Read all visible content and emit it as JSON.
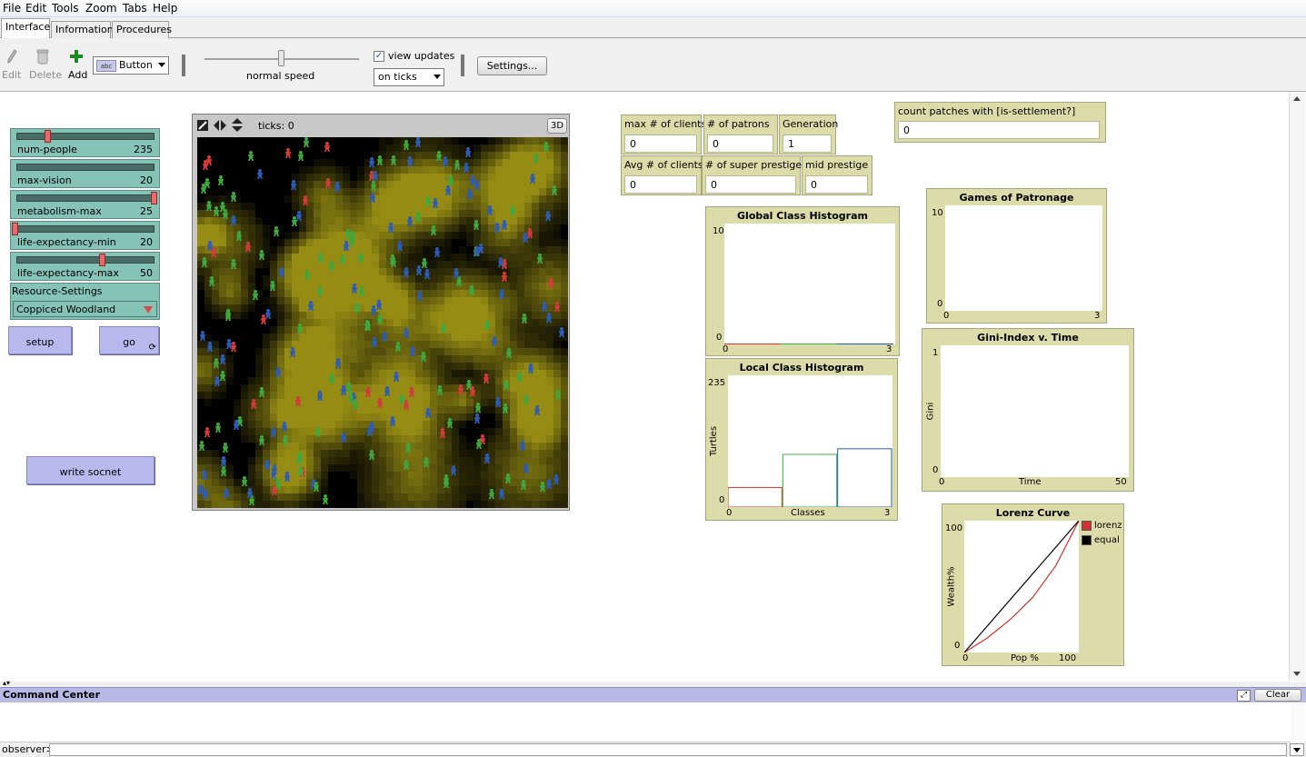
{
  "menu": [
    "File",
    "Edit",
    "Tools",
    "Zoom",
    "Tabs",
    "Help"
  ],
  "tabs": [
    "Interface",
    "Information",
    "Procedures"
  ],
  "toolbar": {
    "edit": "Edit",
    "delete": "Delete",
    "add": "Add",
    "widget_type": "Button",
    "widget_icon_text": "abc",
    "speed_label": "normal speed",
    "view_updates_label": "view updates",
    "update_mode": "on ticks",
    "settings": "Settings..."
  },
  "sliders": [
    {
      "label": "num-people",
      "value": "235",
      "level": 0.24
    },
    {
      "label": "max-vision",
      "value": "20",
      "level": 1.0
    },
    {
      "label": "metabolism-max",
      "value": "25",
      "level": 1.0
    },
    {
      "label": "life-expectancy-min",
      "value": "20",
      "level": 0.0
    },
    {
      "label": "life-expectancy-max",
      "value": "50",
      "level": 0.62
    }
  ],
  "chooser": {
    "label": "Resource-Settings",
    "value": "Coppiced Woodland"
  },
  "buttons": {
    "setup": "setup",
    "go": "go",
    "write_socnet": "write socnet"
  },
  "view": {
    "ticks_label": "ticks: 0",
    "three_d": "3D"
  },
  "monitors": {
    "max_clients": {
      "label": "max # of clients",
      "value": "0"
    },
    "patrons": {
      "label": "# of patrons",
      "value": "0"
    },
    "generation": {
      "label": "Generation",
      "value": "1"
    },
    "avg_clients": {
      "label": "Avg # of clients",
      "value": "0"
    },
    "super_prestige": {
      "label": "# of super prestige",
      "value": "0"
    },
    "mid_prestige": {
      "label": "mid prestige",
      "value": "0"
    },
    "settlement": {
      "label": "count patches with [is-settlement?]",
      "value": "0"
    }
  },
  "plots": {
    "global": {
      "title": "Global Class Histogram",
      "ymax": "10",
      "ymin": "0",
      "xmin": "0",
      "xmax": "3"
    },
    "local": {
      "title": "Local Class Histogram",
      "ymax": "235",
      "ymin": "0",
      "xmin": "0",
      "xmax": "3",
      "xlabel": "Classes",
      "ylabel": "Turtles"
    },
    "patronage": {
      "title": "Games of Patronage",
      "ymax": "10",
      "ymin": "0",
      "xmin": "0",
      "xmax": "3"
    },
    "gini": {
      "title": "Gini-Index v. Time",
      "ymax": "1",
      "ymin": "0",
      "xmin": "0",
      "xmax": "50",
      "xlabel": "Time",
      "ylabel": "Gini"
    },
    "lorenz": {
      "title": "Lorenz Curve",
      "ymax": "100",
      "ymin": "0",
      "xmin": "0",
      "xmax": "100",
      "xlabel": "Pop %",
      "ylabel": "Wealth%",
      "legend": [
        "lorenz",
        "equal"
      ]
    }
  },
  "chart_data": [
    {
      "type": "bar",
      "title": "Local Class Histogram",
      "xlabel": "Classes",
      "ylabel": "Turtles",
      "xlim": [
        0,
        3
      ],
      "ylim": [
        0,
        235
      ],
      "categories": [
        "0-1",
        "1-2",
        "2-3"
      ],
      "series": [
        {
          "values": [
            35,
            94,
            104
          ]
        }
      ],
      "colors": [
        "#d23232",
        "#3cad3c",
        "#2a5aa8"
      ]
    },
    {
      "type": "line",
      "title": "Lorenz Curve",
      "xlabel": "Pop %",
      "ylabel": "Wealth%",
      "xlim": [
        0,
        100
      ],
      "ylim": [
        0,
        100
      ],
      "series": [
        {
          "name": "lorenz",
          "color": "#d23232",
          "x": [
            0,
            20,
            40,
            60,
            80,
            100
          ],
          "y": [
            0,
            11,
            25,
            42,
            66,
            100
          ]
        },
        {
          "name": "equal",
          "color": "#000000",
          "x": [
            0,
            100
          ],
          "y": [
            0,
            100
          ]
        }
      ]
    }
  ],
  "command_center": {
    "title": "Command Center",
    "clear": "Clear",
    "prompt": "observer>"
  }
}
